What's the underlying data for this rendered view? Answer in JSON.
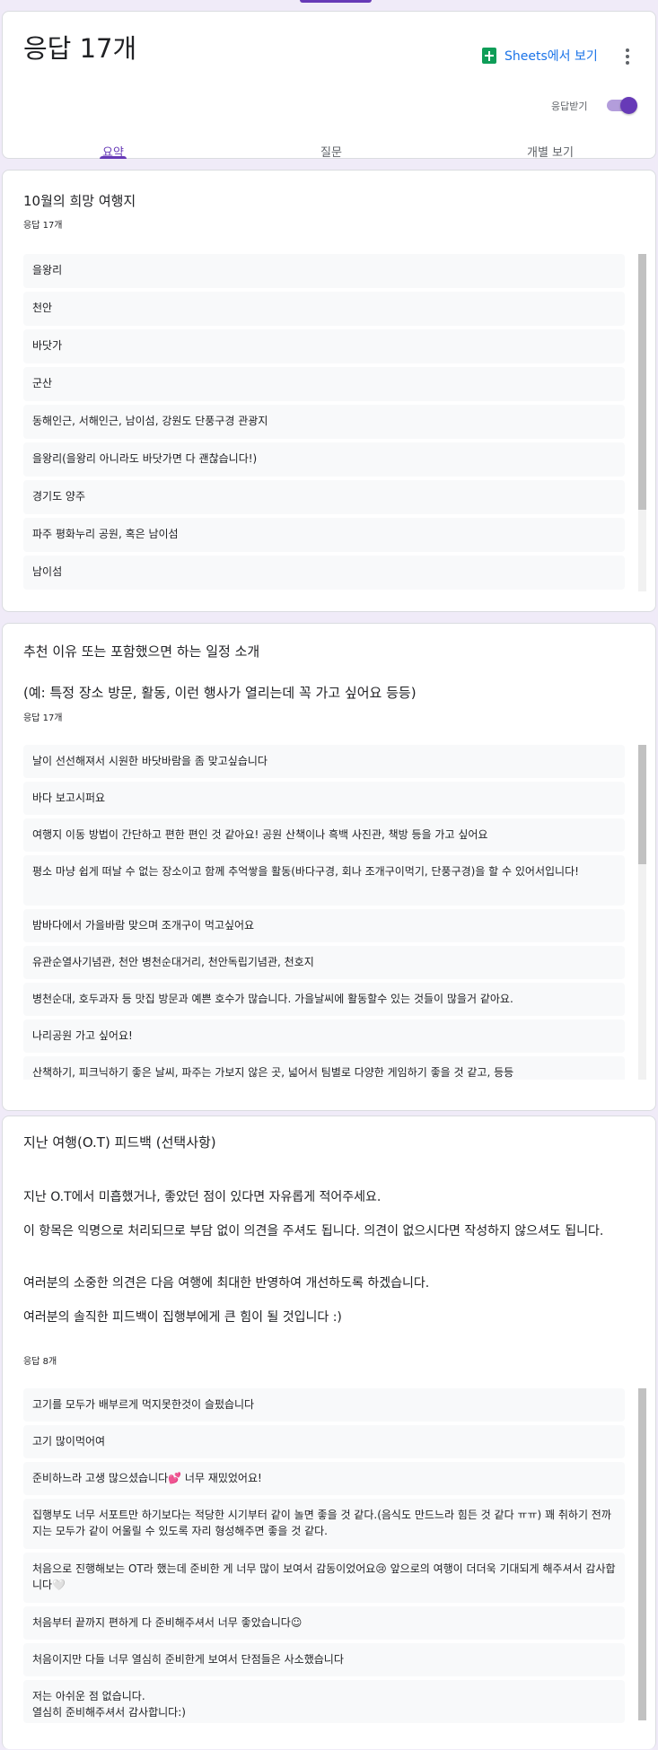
{
  "header": {
    "title": "응답 17개",
    "sheets_label": "Sheets에서 보기",
    "accept_label": "응답받기",
    "accepting": true,
    "tabs": [
      {
        "label": "요약",
        "active": true
      },
      {
        "label": "질문",
        "active": false
      },
      {
        "label": "개별 보기",
        "active": false
      }
    ]
  },
  "colors": {
    "accent": "#673ab7",
    "sheets_green": "#0f9d58",
    "link": "#1a73e8",
    "background": "#f0ebf8"
  },
  "questions": [
    {
      "title": "10월의 희망 여행지",
      "count": "응답 17개",
      "answers": [
        "을왕리",
        "천안",
        "바닷가",
        "군산",
        "동해인근, 서해인근, 남이섬, 강원도 단풍구경 관광지",
        "을왕리(을왕리 아니라도 바닷가면 다 괜찮습니다!)",
        "경기도 양주",
        "파주 평화누리 공원, 혹은 남이섬",
        "남이섬"
      ]
    },
    {
      "title": "추천 이유 또는 포함했으면 하는 일정 소개",
      "description": "(예: 특정 장소 방문, 활동, 이런 행사가 열리는데 꼭 가고 싶어요 등등)",
      "count": "응답 17개",
      "answers": [
        "날이 선선해져서 시원한 바닷바람을 좀 맞고싶습니다",
        "바다 보고시퍼요",
        "여행지 이동 방법이 간단하고 편한 편인 것 같아요! 공원 산책이나 흑백 사진관, 책방 등을 가고 싶어요",
        "평소 마냥 쉽게 떠날 수 없는 장소이고 함께 추억쌓을 활동(바다구경, 회나 조개구이먹기, 단풍구경)을 할 수 있어서입니다!",
        "밤바다에서 가을바람 맞으며 조개구이 먹고싶어요",
        "유관순열사기념관, 천안 병천순대거리, 천안독립기념관, 천호지",
        "병천순대, 호두과자 등 맛집 방문과 예쁜 호수가 많습니다. 가을날씨에 활동할수 있는 것들이 많을거 같아요.",
        "나리공원 가고 싶어요!",
        "산책하기, 피크닉하기 좋은 날씨, 파주는 가보지 않은 곳, 넓어서 팀별로 다양한 게임하기 좋을 것 같고, 등등"
      ]
    },
    {
      "title": "지난 여행(O.T) 피드백 (선택사항)",
      "description_lines": [
        "지난 O.T에서 미흡했거나, 좋았던 점이 있다면 자유롭게 적어주세요.",
        "이 항목은 익명으로 처리되므로 부담 없이 의견을 주셔도 됩니다. 의견이 없으시다면 작성하지 않으셔도 됩니다.",
        "여러분의 소중한 의견은 다음 여행에 최대한 반영하여 개선하도록 하겠습니다.",
        "여러분의 솔직한 피드백이 집행부에게 큰 힘이 될 것입니다 :)"
      ],
      "count": "응답 8개",
      "answers": [
        "고기를 모두가 배부르게 먹지못한것이 슬펐습니다",
        "고기 많이먹어여",
        "준비하느라 고생 많으셨습니다💕 너무 재밌었어요!",
        "집행부도 너무 서포트만 하기보다는 적당한 시기부터 같이 놀면 좋을 것 같다.(음식도 만드느라 힘든 것 같다 ㅠㅠ) 꽤 취하기 전까지는 모두가 같이 어울릴 수 있도록 자리 형성해주면 좋을 것 같다.",
        "처음으로 진행해보는 OT라 했는데 준비한 게 너무 많이 보여서 감동이었어요😢 앞으로의 여행이 더더욱 기대되게 해주셔서 감사합니다🤍",
        "처음부터 끝까지 편하게 다 준비해주셔서 너무 좋았습니다☺",
        "처음이지만 다들 너무 열심히 준비한게 보여서 단점들은 사소했습니다",
        "저는 아쉬운 점 없습니다.\n열심히 준비해주셔서 감사합니다:)"
      ]
    }
  ]
}
